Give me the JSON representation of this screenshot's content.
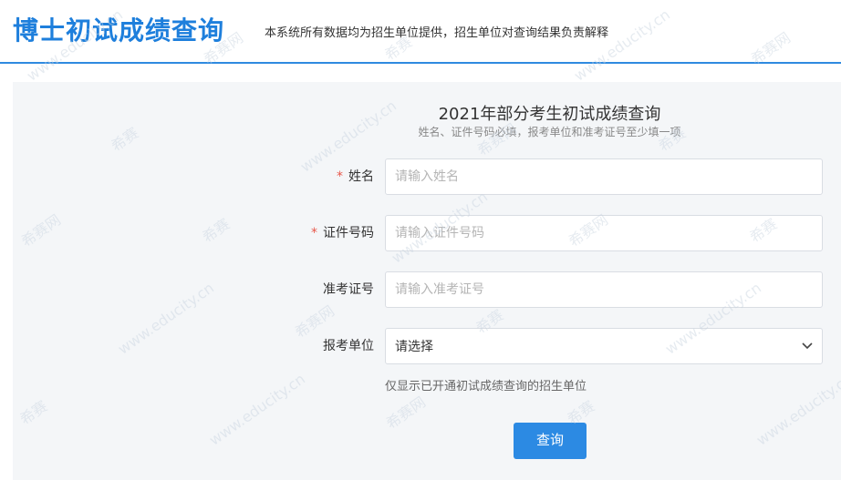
{
  "header": {
    "title": "博士初试成绩查询",
    "note": "本系统所有数据均为招生单位提供，招生单位对查询结果负责解释"
  },
  "form": {
    "title": "2021年部分考生初试成绩查询",
    "subtitle": "姓名、证件号码必填，报考单位和准考证号至少填一项",
    "fields": {
      "name": {
        "required_mark": "*",
        "label": "姓名",
        "placeholder": "请输入姓名",
        "value": ""
      },
      "id_number": {
        "required_mark": "*",
        "label": "证件号码",
        "placeholder": "请输入证件号码",
        "value": ""
      },
      "admission_number": {
        "label": "准考证号",
        "placeholder": "请输入准考证号",
        "value": ""
      },
      "institution": {
        "label": "报考单位",
        "selected": "请选择",
        "chevron_icon": "chevron-down-icon"
      }
    },
    "hint": "仅显示已开通初试成绩查询的招生单位",
    "submit_label": "查询"
  },
  "watermark": {
    "texts": [
      "www.educity.cn",
      "希赛网",
      "希赛"
    ]
  },
  "colors": {
    "brand_blue": "#1e7fdc",
    "button_blue": "#2c8ae3",
    "required_red": "#e8574a",
    "panel_bg": "#f4f6f8"
  }
}
